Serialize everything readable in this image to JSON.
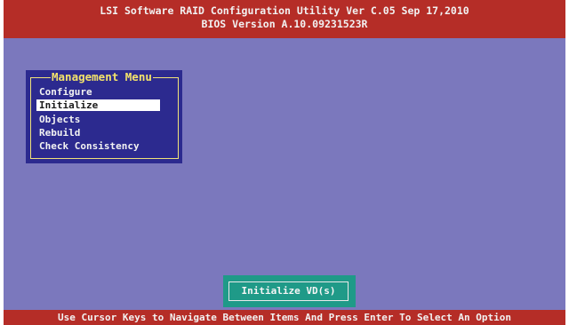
{
  "header": {
    "line1": "LSI Software RAID Configuration Utility Ver C.05 Sep 17,2010",
    "line2": "BIOS Version  A.10.09231523R"
  },
  "management_menu": {
    "title": "Management Menu",
    "items": [
      {
        "label": "Configure",
        "selected": false
      },
      {
        "label": "Initialize",
        "selected": true
      },
      {
        "label": "Objects",
        "selected": false
      },
      {
        "label": "Rebuild",
        "selected": false
      },
      {
        "label": "Check Consistency",
        "selected": false
      }
    ]
  },
  "action_panel": {
    "label": "Initialize VD(s)"
  },
  "status_bar": {
    "text": "Use Cursor Keys to Navigate Between Items And Press Enter To Select An Option"
  },
  "colors": {
    "background": "#7b78bd",
    "header_bg": "#b52d27",
    "menu_bg": "#2c2a8f",
    "menu_title": "#f3e36b",
    "selection_bg": "#ffffff",
    "action_bg": "#1f9a88"
  }
}
